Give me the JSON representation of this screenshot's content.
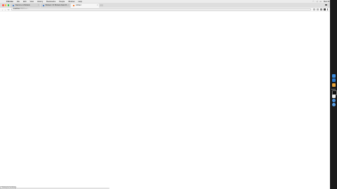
{
  "menubar": {
    "apple": "",
    "app_name": "Chrome",
    "items": [
      "File",
      "Edit",
      "View",
      "History",
      "Bookmarks",
      "People",
      "Window",
      "Help"
    ],
    "status_right": "Wed 10:41  Q  ≡"
  },
  "tabs": [
    {
      "title": "Welcome to Biobank",
      "active": false
    },
    {
      "title": "Biobank: UK Biobank Data Sh...",
      "active": false
    },
    {
      "title": "Untitled",
      "active": true
    }
  ],
  "toolbar": {
    "back": "‹",
    "forward": "›",
    "reload": "↻",
    "url_host": "localhost",
    "url_path": ":8888/tree/..."
  },
  "statusbar": {
    "text": "Waiting for localhost..."
  },
  "colors": {
    "traffic_close": "#ff5f57",
    "traffic_min": "#febc2e",
    "traffic_max": "#28c840",
    "dock_bg": "#1b1b1b"
  },
  "dock_icons": [
    "finder-icon",
    "safari-icon",
    "terminal-icon",
    "mail-icon",
    "notes-icon",
    "settings-icon",
    "chrome-icon"
  ]
}
